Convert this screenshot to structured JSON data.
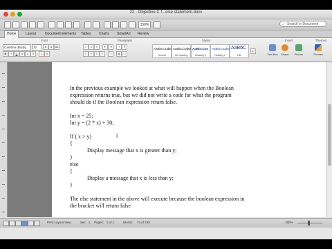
{
  "window": {
    "title": "22 - Objective C f...else statement.docx"
  },
  "toolbar": {
    "zoom": "150%",
    "search_placeholder": "Search in Document"
  },
  "tabs": [
    {
      "label": "Home",
      "active": true
    },
    {
      "label": "Layout",
      "active": false
    },
    {
      "label": "Document Elements",
      "active": false
    },
    {
      "label": "Tables",
      "active": false
    },
    {
      "label": "Charts",
      "active": false
    },
    {
      "label": "SmartArt",
      "active": false
    },
    {
      "label": "Review",
      "active": false
    }
  ],
  "ribbon": {
    "font_group_label": "Font",
    "paragraph_group_label": "Paragraph",
    "styles_group_label": "Styles",
    "insert_group_label": "Insert",
    "themes_group_label": "Themes",
    "font_name": "Cambria (Body)",
    "font_size": "12",
    "styles": [
      {
        "sample": "AaBbCcDdEe",
        "name": "Normal"
      },
      {
        "sample": "AaBbCcDdEe",
        "name": "No Spacing"
      },
      {
        "sample": "AaBbCcDc",
        "name": "Heading 1"
      },
      {
        "sample": "AaBbCcDdEe",
        "name": "Heading 2"
      },
      {
        "sample": "AaBbC",
        "name": "Title"
      }
    ],
    "insert_buttons": [
      {
        "label": "Text Box",
        "icon": "text-box-icon",
        "color": "#6d8fc7"
      },
      {
        "label": "Shape",
        "icon": "shape-icon",
        "color": "#e08a2e"
      },
      {
        "label": "Picture",
        "icon": "picture-icon",
        "color": "#5aa36a"
      }
    ],
    "themes_label": "Themes"
  },
  "document": {
    "lines": [
      "In the previous example we looked at what will happen when the Boolean",
      "expression returns true, but we did not write a code for what the program",
      "should do if the Boolean expression return false.",
      "",
      "Int x = 25;",
      "Int y = (2 * x) + 30;",
      "",
      "If ( x > y)",
      "{",
      "Display message that x is greater than y;",
      "}",
      "else",
      "{",
      "Display a message that x is less than y;",
      "}",
      "",
      "The else statement in the above will execute because the boolean expression in",
      "the bracket will return false"
    ]
  },
  "statusbar": {
    "view": "Print Layout View",
    "sec": "Sec",
    "sec_value": "1",
    "pages_label": "Pages:",
    "pages_value": "1 of 1",
    "words_label": "Words:",
    "words_value": "74 of 139",
    "zoom": "150%"
  },
  "colors": {
    "close": "#e0443e",
    "minimize": "#dea123",
    "maximize": "#1aab29"
  }
}
